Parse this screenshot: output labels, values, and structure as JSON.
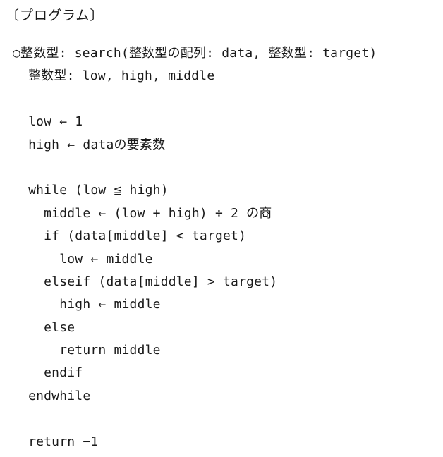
{
  "heading": "〔プログラム〕",
  "program": {
    "lines": [
      "○整数型: search(整数型の配列: data, 整数型: target)",
      "  整数型: low, high, middle",
      "",
      "  low ← 1",
      "  high ← dataの要素数",
      "",
      "  while (low ≦ high)",
      "    middle ← (low + high) ÷ 2 の商",
      "    if (data[middle] < target)",
      "      low ← middle",
      "    elseif (data[middle] > target)",
      "      high ← middle",
      "    else",
      "      return middle",
      "    endif",
      "  endwhile",
      "",
      "  return −1"
    ]
  }
}
